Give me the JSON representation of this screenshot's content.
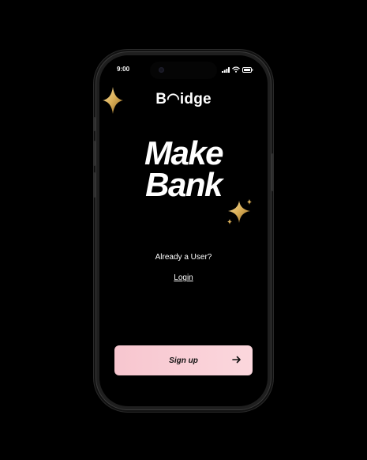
{
  "status_bar": {
    "time": "9:00",
    "icons": [
      "signal-icon",
      "wifi-icon",
      "battery-icon"
    ]
  },
  "app": {
    "logo_text": "B◠idge",
    "headline_line1": "Make",
    "headline_line2": "Bank"
  },
  "auth": {
    "prompt": "Already a User?",
    "login_label": "Login",
    "signup_label": "Sign up",
    "signup_icon": "arrow-right-icon"
  },
  "colors": {
    "background": "#000000",
    "button": "#f9ccd4",
    "sparkle": "#d9b46a",
    "text": "#ffffff"
  }
}
